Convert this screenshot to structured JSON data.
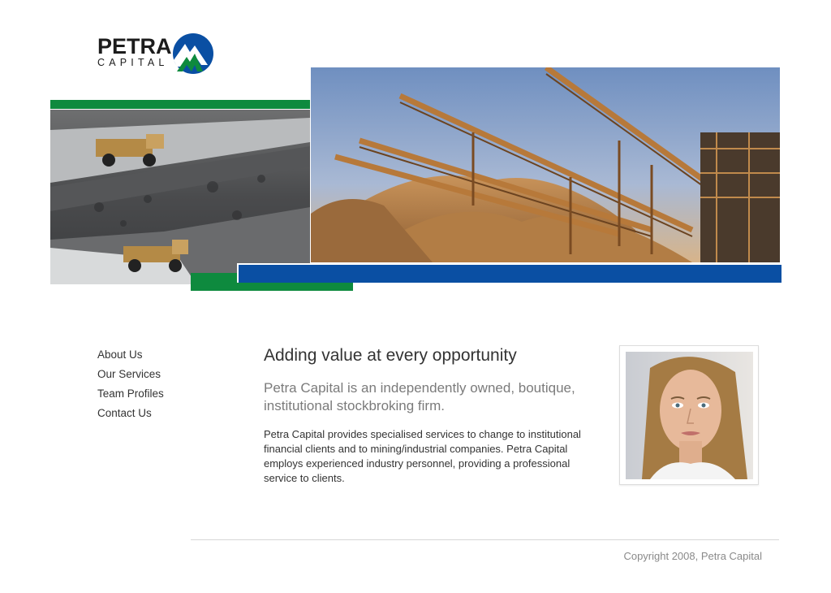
{
  "brand": {
    "name": "PETRA",
    "sub": "CAPITAL",
    "colors": {
      "green": "#0e8a3e",
      "blue": "#0a4fa3",
      "dark": "#1c1c1c"
    }
  },
  "hero": {
    "left_image": "open-pit-mine-trucks",
    "right_image": "conveyor-stockpiles"
  },
  "nav": {
    "items": [
      {
        "label": "About Us"
      },
      {
        "label": "Our Services"
      },
      {
        "label": "Team Profiles"
      },
      {
        "label": "Contact Us"
      }
    ]
  },
  "main": {
    "title": "Adding value at every opportunity",
    "lead": "Petra Capital is an independently owned, boutique, institutional stockbroking firm.",
    "body": "Petra Capital provides specialised services to change to institutional financial clients and to mining/industrial companies. Petra Capital employs experienced industry personnel, providing a professional service to clients."
  },
  "portrait": {
    "subject": "woman-portrait"
  },
  "footer": {
    "copyright": "Copyright 2008, Petra Capital"
  }
}
